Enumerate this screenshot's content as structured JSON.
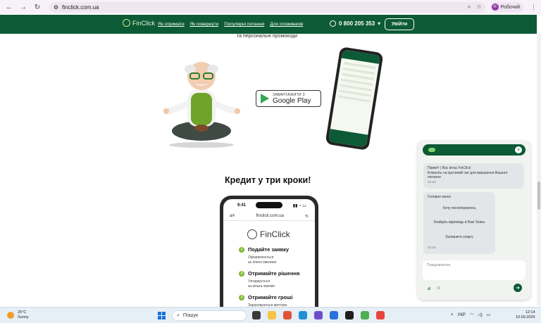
{
  "browser": {
    "url": "finclick.com.ua",
    "profile_initial": "Н",
    "profile_label": "Робочий"
  },
  "header": {
    "logo_text": "FinClick",
    "menu": [
      "Як отримати",
      "Як повернути",
      "Популярні питання",
      "Для споживачів"
    ],
    "phone": "0 800 205 353",
    "login_label": "Увійти"
  },
  "promo": {
    "tail_text": "та персональні промокоди",
    "gplay_small": "ЗАВАНТАЖИТИ З",
    "gplay_big": "Google Play"
  },
  "steps_section": {
    "title": "Кредит у три кроки!",
    "phone_time": "9:41",
    "phone_url_left": "аА",
    "phone_url": "finclick.com.ua",
    "logo_text": "FinClick",
    "steps": [
      {
        "num": "1",
        "title": "Подайте заявку",
        "desc1": "Оформлюється",
        "desc2": "за лічені хвилини"
      },
      {
        "num": "2",
        "title": "Отримайте рішення",
        "desc1": "Узгоджується",
        "desc2": "за кілька хвилин"
      },
      {
        "num": "3",
        "title": "Отримайте гроші",
        "desc1": "Зараховуються миттєво",
        "desc2": ""
      }
    ]
  },
  "chat": {
    "greeting_line1": "Привіт! | Вас вітає FinClick",
    "greeting_line2": "Кліканіть на крутиний чат для вирішення Вашого",
    "greeting_line3": "питання",
    "greeting_time": "12:14",
    "menu_title": "Головне меню",
    "menu_options": [
      "Хочу поспілкуватись",
      "Знайдіть відповідь в Базі Знань",
      "Залишити скаргу"
    ],
    "menu_time": "12:14",
    "input_placeholder": "Повідомлення"
  },
  "taskbar": {
    "temperature": "25°C",
    "weather": "Sunny",
    "search_placeholder": "Пошук",
    "language": "УКР",
    "time": "12:14",
    "date": "10.09.2026"
  },
  "colors": {
    "brand_green": "#0c5a36",
    "accent_lime": "#7cb82f"
  }
}
